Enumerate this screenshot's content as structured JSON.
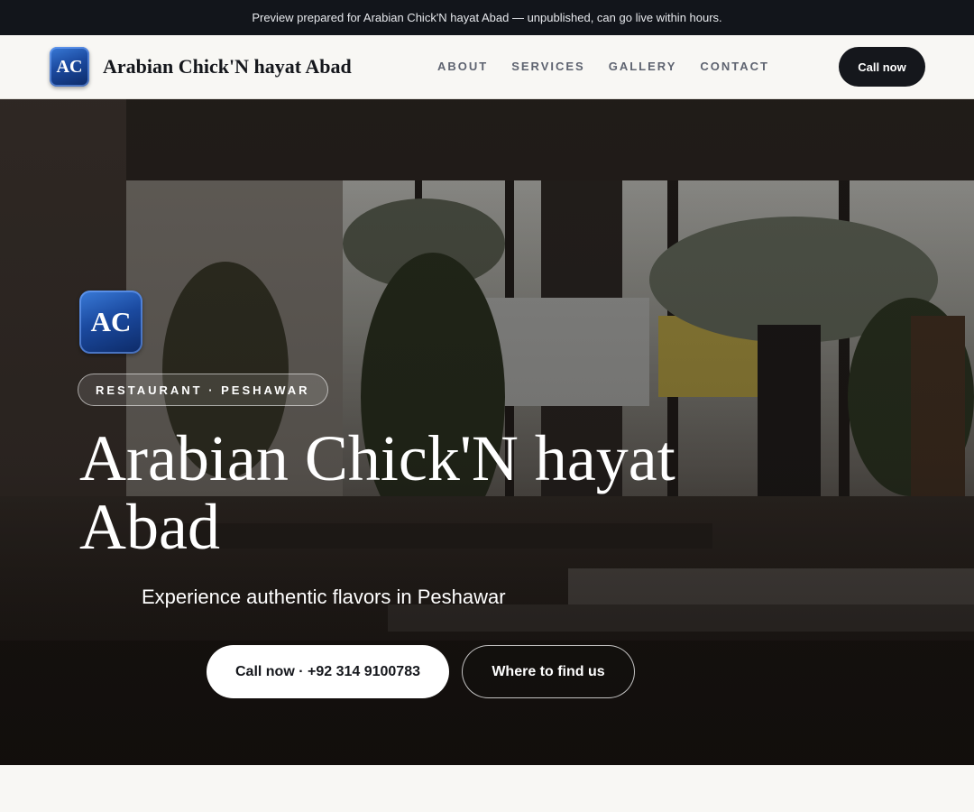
{
  "preview_banner": {
    "text": "Preview prepared for Arabian Chick'N hayat Abad — unpublished, can go live within hours."
  },
  "nav": {
    "logo_initials": "AC",
    "brand_name": "Arabian Chick'N hayat Abad",
    "links": [
      "ABOUT",
      "SERVICES",
      "GALLERY",
      "CONTACT"
    ],
    "cta_label": "Call now"
  },
  "hero": {
    "logo_initials": "AC",
    "tagline": "RESTAURANT · PESHAWAR",
    "title": "Arabian Chick'N hayat Abad",
    "subtitle": "Experience authentic flavors in Peshawar",
    "primary_button": "Call now · +92 314 9100783",
    "secondary_button": "Where to find us",
    "background_image": "restaurant interior with windows and street view"
  },
  "colors": {
    "dark": "#15171c",
    "banner_bg": "#12151b",
    "page_bg": "#f8f7f4",
    "badge_blue": "#1b4aa0"
  }
}
